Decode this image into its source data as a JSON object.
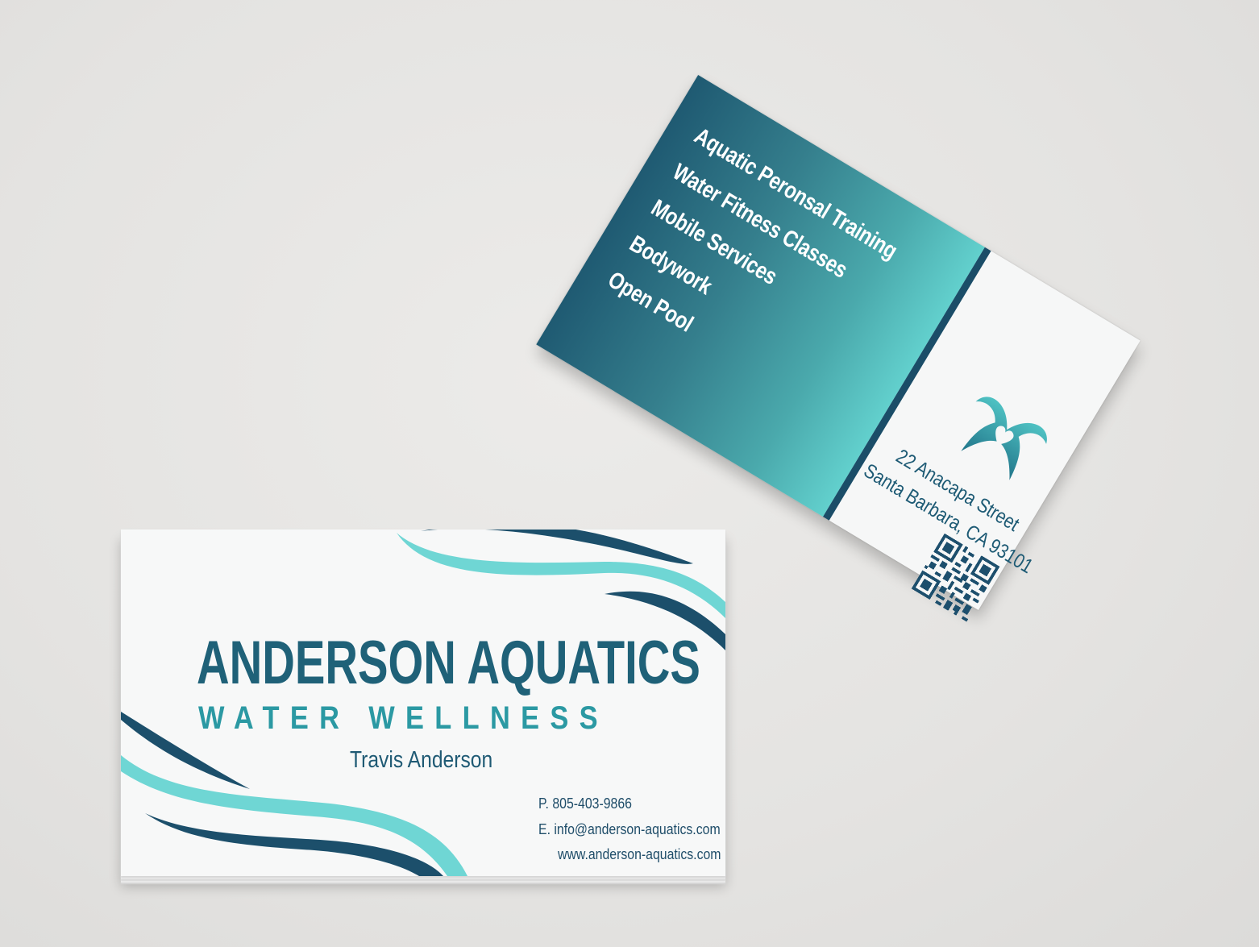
{
  "back_card": {
    "services": [
      "Aquatic Peronsal Training",
      "Water Fitness  Classes",
      "Mobile Services",
      "Bodywork",
      "Open Pool"
    ],
    "address_line1": "22 Anacapa Street",
    "address_line2": "Santa Barbara, CA 93101",
    "logo_icon": "heart-wings-icon",
    "qr_icon": "qr-code-icon"
  },
  "front_card": {
    "company_name": "ANDERSON AQUATICS",
    "tagline": "WATER WELLNESS",
    "person_name": "Travis Anderson",
    "phone": "P.  805-403-9866",
    "email": "E.  info@anderson-aquatics.com",
    "website": "www.anderson-aquatics.com"
  },
  "colors": {
    "navy": "#1f5a74",
    "teal": "#2b99a3",
    "aqua": "#6fd6d4",
    "dark_wave": "#1c4f6b"
  }
}
